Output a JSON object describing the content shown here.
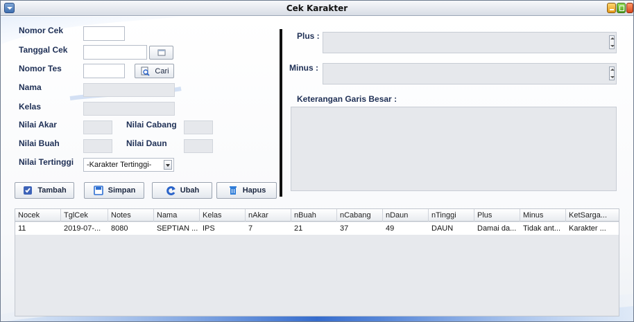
{
  "window": {
    "title": "Cek Karakter"
  },
  "form": {
    "labels": {
      "nomor_cek": "Nomor Cek",
      "tanggal_cek": "Tanggal Cek",
      "nomor_tes": "Nomor Tes",
      "nama": "Nama",
      "kelas": "Kelas",
      "nilai_akar": "Nilai Akar",
      "nilai_cabang": "Nilai Cabang",
      "nilai_buah": "Nilai Buah",
      "nilai_daun": "Nilai Daun",
      "nilai_tertinggi": "Nilai Tertinggi"
    },
    "values": {
      "nomor_cek": "",
      "tanggal_cek": "",
      "nomor_tes": "",
      "nama": "",
      "kelas": "",
      "nilai_akar": "",
      "nilai_cabang": "",
      "nilai_buah": "",
      "nilai_daun": ""
    },
    "cari_label": "Cari",
    "tertinggi_selected": "-Karakter Tertinggi-"
  },
  "right_panel": {
    "plus_label": "Plus :",
    "minus_label": "Minus :",
    "keterangan_label": "Keterangan Garis Besar :",
    "plus_value": "",
    "minus_value": "",
    "keterangan_value": ""
  },
  "buttons": {
    "tambah": "Tambah",
    "simpan": "Simpan",
    "ubah": "Ubah",
    "hapus": "Hapus"
  },
  "table": {
    "columns": [
      "Nocek",
      "TglCek",
      "Notes",
      "Nama",
      "Kelas",
      "nAkar",
      "nBuah",
      "nCabang",
      "nDaun",
      "nTinggi",
      "Plus",
      "Minus",
      "KetSarga..."
    ],
    "rows": [
      [
        "11",
        "2019-07-...",
        "8080",
        "SEPTIAN ...",
        "IPS",
        "7",
        "21",
        "37",
        "49",
        "DAUN",
        "Damai da...",
        "Tidak ant...",
        "Karakter ..."
      ]
    ]
  },
  "colors": {
    "label_text": "#1e2f55",
    "readonly_field": "#e6e8ec",
    "divider": "#111111",
    "swoosh_blue": "#2a63c9"
  }
}
